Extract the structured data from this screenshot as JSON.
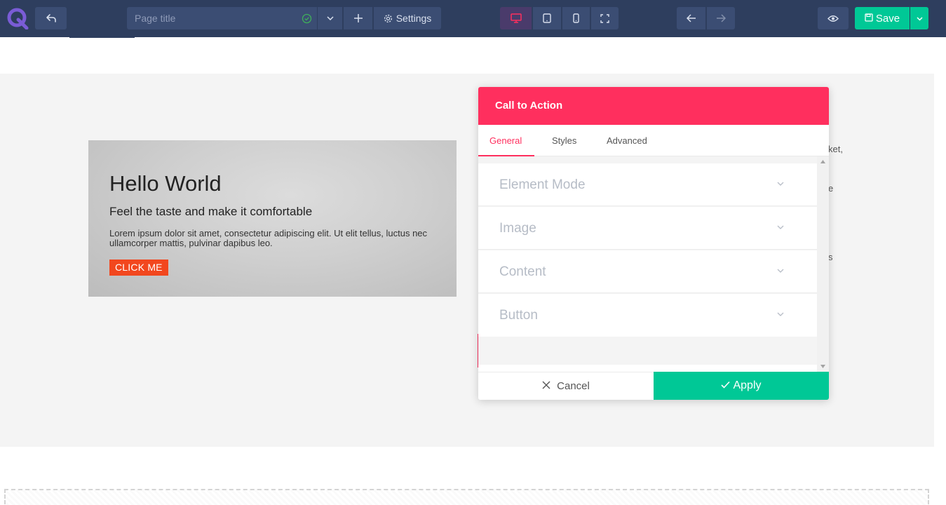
{
  "toolbar": {
    "page_title_placeholder": "Page title",
    "settings_label": "Settings",
    "save_label": "Save"
  },
  "canvas": {
    "cta": {
      "title": "Hello World",
      "subtitle": "Feel the taste and make it comfortable",
      "text": "Lorem ipsum dolor sit amet, consectetur adipiscing elit. Ut elit tellus, luctus nec ullamcorper mattis, pulvinar dapibus leo.",
      "button_label": "CLICK ME"
    },
    "side_fragments": [
      "ket,",
      "e",
      "s"
    ]
  },
  "modal": {
    "title": "Call to Action",
    "tabs": [
      {
        "label": "General"
      },
      {
        "label": "Styles"
      },
      {
        "label": "Advanced"
      }
    ],
    "sections": [
      {
        "label": "Element Mode"
      },
      {
        "label": "Image"
      },
      {
        "label": "Content"
      },
      {
        "label": "Button"
      }
    ],
    "cancel_label": "Cancel",
    "apply_label": "Apply"
  },
  "colors": {
    "toolbar_bg": "#2e3e5e",
    "toolbar_button": "#3b4d73",
    "accent_pink": "#ff2f5e",
    "accent_green": "#00c896",
    "cta_button": "#f2471e"
  }
}
